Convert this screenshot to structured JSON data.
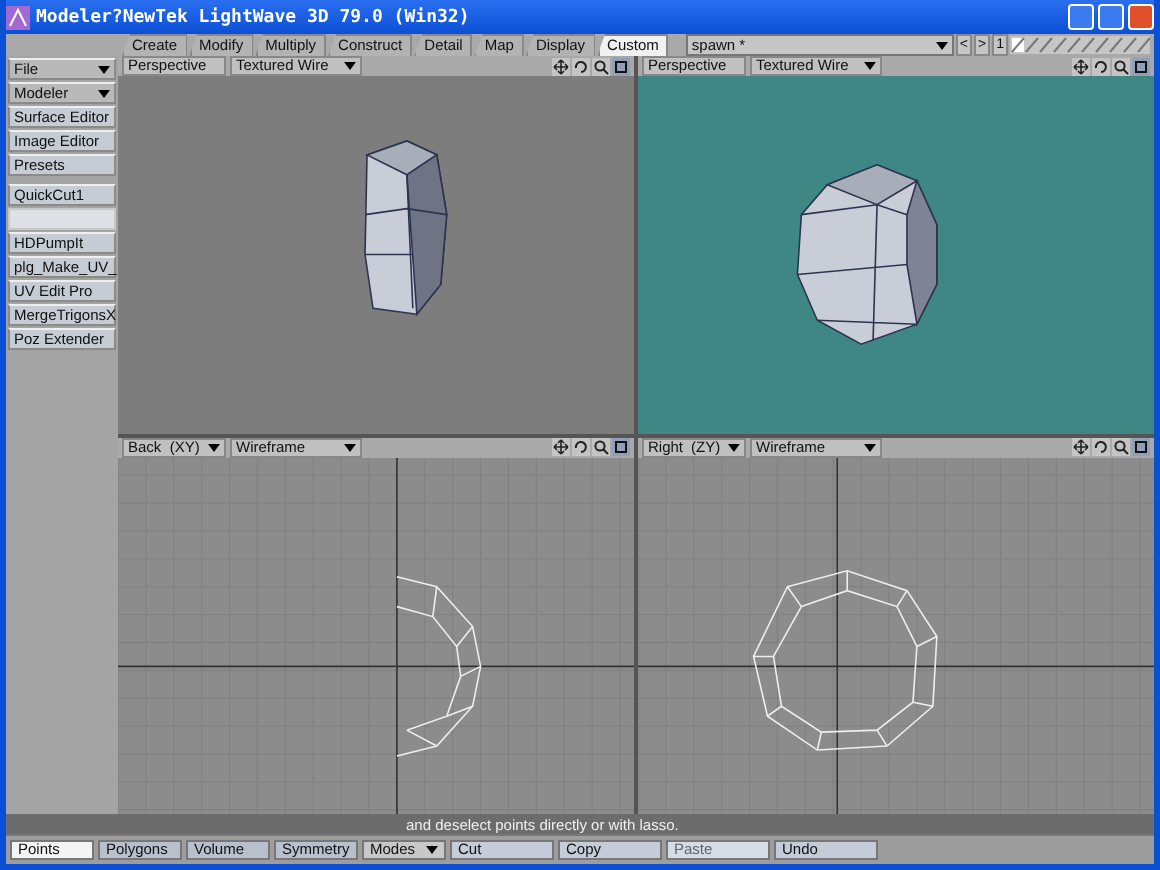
{
  "window": {
    "title": "Modeler?NewTek LightWave 3D 79.0 (Win32)"
  },
  "tabs": [
    {
      "label": "Create",
      "selected": false
    },
    {
      "label": "Modify",
      "selected": false
    },
    {
      "label": "Multiply",
      "selected": false
    },
    {
      "label": "Construct",
      "selected": false
    },
    {
      "label": "Detail",
      "selected": false
    },
    {
      "label": "Map",
      "selected": false
    },
    {
      "label": "Display",
      "selected": false
    },
    {
      "label": "Custom",
      "selected": true
    }
  ],
  "object_selector": {
    "value": "spawn *",
    "prev_label": "<",
    "next_label": ">",
    "layer_number": "1"
  },
  "sidebar": {
    "menus": [
      {
        "label": "File"
      },
      {
        "label": "Modeler"
      }
    ],
    "items": [
      {
        "label": "Surface Editor"
      },
      {
        "label": "Image Editor"
      },
      {
        "label": "Presets"
      }
    ],
    "plugins": [
      {
        "label": "QuickCut1",
        "disabled": false
      },
      {
        "disabled": true
      },
      {
        "label": "HDPumpIt",
        "disabled": false
      },
      {
        "label": "plg_Make_UV_",
        "disabled": false
      },
      {
        "label": "UV Edit Pro",
        "disabled": false
      },
      {
        "label": "MergeTrigonsX",
        "disabled": false
      },
      {
        "label": "Poz Extender",
        "disabled": false
      }
    ]
  },
  "viewports": [
    {
      "kind": "perspective",
      "view": "Perspective",
      "mode": "Textured Wire",
      "selected": false
    },
    {
      "kind": "perspective",
      "view": "Perspective",
      "mode": "Textured Wire",
      "selected": true
    },
    {
      "kind": "back",
      "view": "Back",
      "axes": "(XY)",
      "mode": "Wireframe",
      "selected": false
    },
    {
      "kind": "right",
      "view": "Right",
      "axes": "(ZY)",
      "mode": "Wireframe",
      "selected": false
    }
  ],
  "status_bar": {
    "hint": "and deselect points directly or with lasso.",
    "buttons": [
      {
        "kind": "toggle",
        "label": "Points",
        "selected": true
      },
      {
        "kind": "toggle",
        "label": "Polygons",
        "selected": false
      },
      {
        "kind": "toggle",
        "label": "Volume",
        "selected": false
      },
      {
        "kind": "toggle",
        "label": "Symmetry",
        "selected": false
      },
      {
        "kind": "menu",
        "label": "Modes"
      },
      {
        "kind": "action",
        "label": "Cut",
        "disabled": false
      },
      {
        "kind": "action",
        "label": "Copy",
        "disabled": false
      },
      {
        "kind": "action",
        "label": "Paste",
        "disabled": true
      },
      {
        "kind": "action",
        "label": "Undo",
        "disabled": false
      }
    ]
  }
}
